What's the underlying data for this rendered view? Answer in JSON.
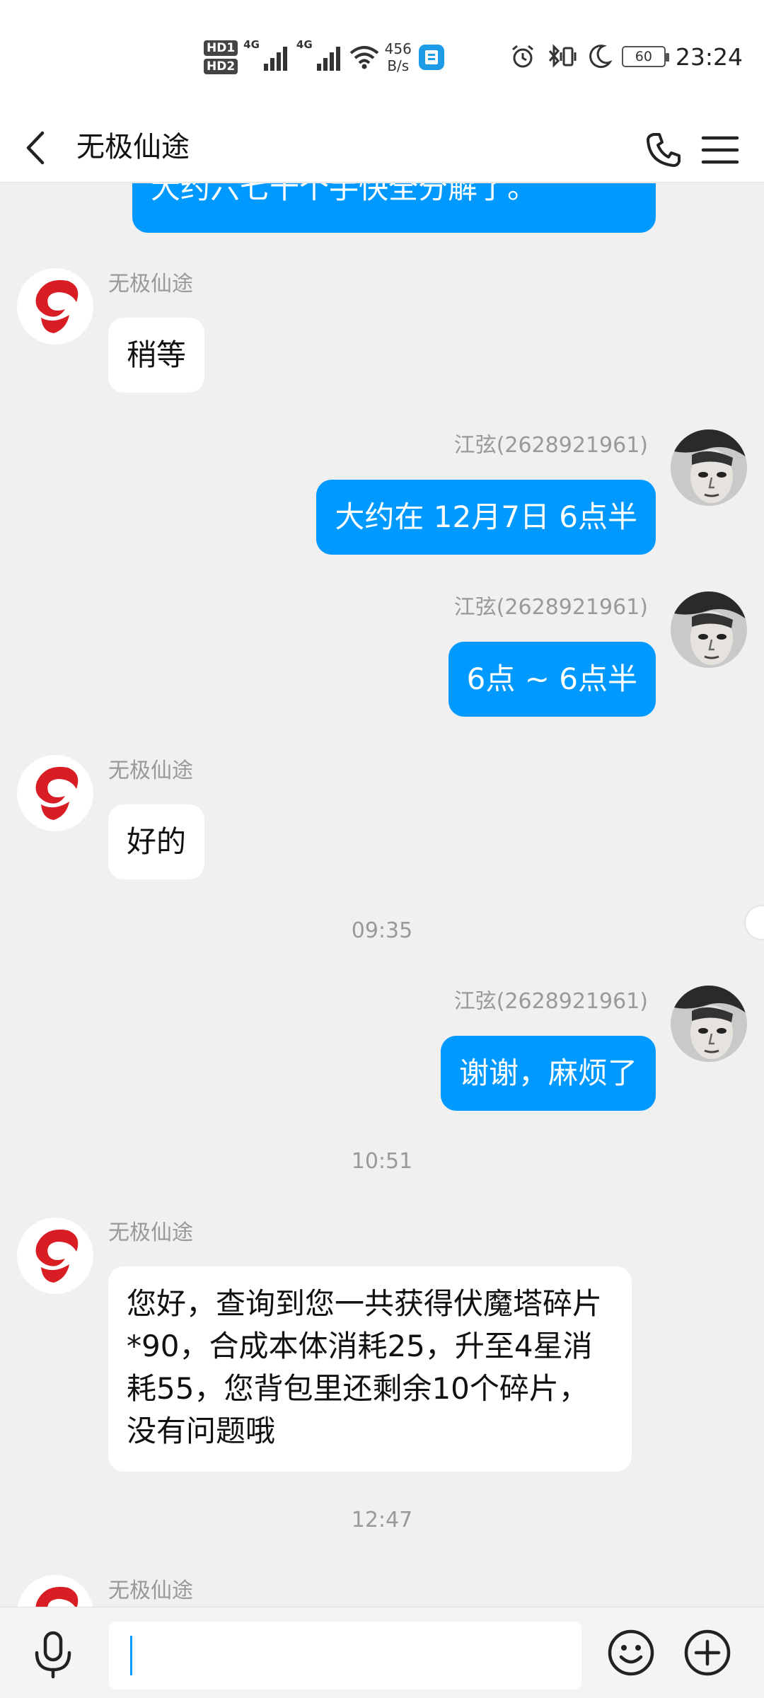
{
  "status_bar": {
    "hd1": "HD1",
    "hd2": "HD2",
    "net1": "4G",
    "net2": "4G",
    "speed_value": "456",
    "speed_unit": "B/s",
    "battery": "60",
    "time": "23:24"
  },
  "header": {
    "title": "无极仙途"
  },
  "messages": [
    {
      "type": "out",
      "text": "大约六七十个手快全分解了。"
    },
    {
      "type": "in",
      "sender": "无极仙途",
      "text": "稍等"
    },
    {
      "type": "out",
      "sender": "江弦(2628921961)",
      "text": "大约在 12月7日 6点半"
    },
    {
      "type": "out",
      "sender": "江弦(2628921961)",
      "text": "6点 ~ 6点半"
    },
    {
      "type": "in",
      "sender": "无极仙途",
      "text": "好的"
    },
    {
      "type": "time",
      "text": "09:35"
    },
    {
      "type": "out",
      "sender": "江弦(2628921961)",
      "text": "谢谢，麻烦了"
    },
    {
      "type": "time",
      "text": "10:51"
    },
    {
      "type": "in",
      "sender": "无极仙途",
      "text": "您好，查询到您一共获得伏魔塔碎片*90，合成本体消耗25，升至4星消耗55，您背包里还剩余10个碎片，没有问题哦"
    },
    {
      "type": "time",
      "text": "12:47"
    },
    {
      "type": "in",
      "sender": "无极仙途",
      "text": ""
    }
  ],
  "input": {
    "value": "",
    "placeholder": ""
  },
  "colors": {
    "outgoing_bubble": "#0099ff",
    "incoming_bubble": "#ffffff",
    "chat_background": "#f0f0f0",
    "avatar_logo": "#d81e24"
  },
  "icons": {
    "back": "chevron-left-icon",
    "call": "phone-icon",
    "menu": "hamburger-menu-icon",
    "mic": "microphone-icon",
    "emoji": "smiley-icon",
    "more": "plus-circle-icon"
  }
}
